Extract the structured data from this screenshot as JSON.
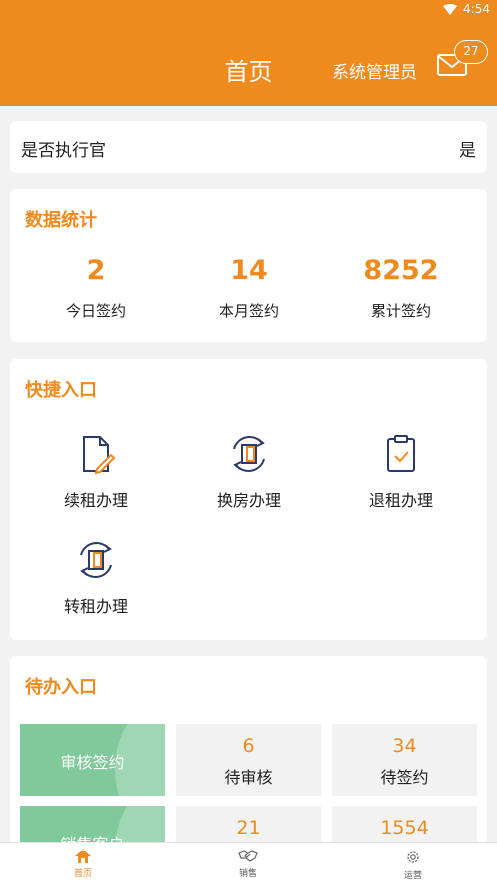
{
  "status_bar": {
    "time": "4:54"
  },
  "header": {
    "title": "首页",
    "user": "系统管理员",
    "badge_count": "27"
  },
  "exec": {
    "label": "是否执行官",
    "value": "是"
  },
  "stats": {
    "title": "数据统计",
    "items": [
      {
        "value": "2",
        "label": "今日签约"
      },
      {
        "value": "14",
        "label": "本月签约"
      },
      {
        "value": "8252",
        "label": "累计签约"
      }
    ]
  },
  "quick": {
    "title": "快捷入口",
    "items": [
      {
        "label": "续租办理",
        "icon": "document-edit-icon"
      },
      {
        "label": "换房办理",
        "icon": "door-rotate-icon"
      },
      {
        "label": "退租办理",
        "icon": "clipboard-check-icon"
      },
      {
        "label": "转租办理",
        "icon": "door-rotate-icon"
      }
    ]
  },
  "todo": {
    "title": "待办入口",
    "rows": [
      {
        "category": "审核签约",
        "cells": [
          {
            "value": "6",
            "label": "待审核"
          },
          {
            "value": "34",
            "label": "待签约"
          }
        ]
      },
      {
        "category": "销售客户",
        "cells": [
          {
            "value": "21",
            "label": ""
          },
          {
            "value": "1554",
            "label": ""
          }
        ]
      }
    ]
  },
  "tabbar": {
    "items": [
      {
        "label": "首页",
        "icon": "home-icon",
        "active": true
      },
      {
        "label": "销售",
        "icon": "handshake-icon",
        "active": false
      },
      {
        "label": "运营",
        "icon": "gear-icon",
        "active": false
      }
    ]
  },
  "colors": {
    "accent": "#ef8a1f",
    "green": "#7fc99a",
    "icon_navy": "#2b3a6b"
  }
}
